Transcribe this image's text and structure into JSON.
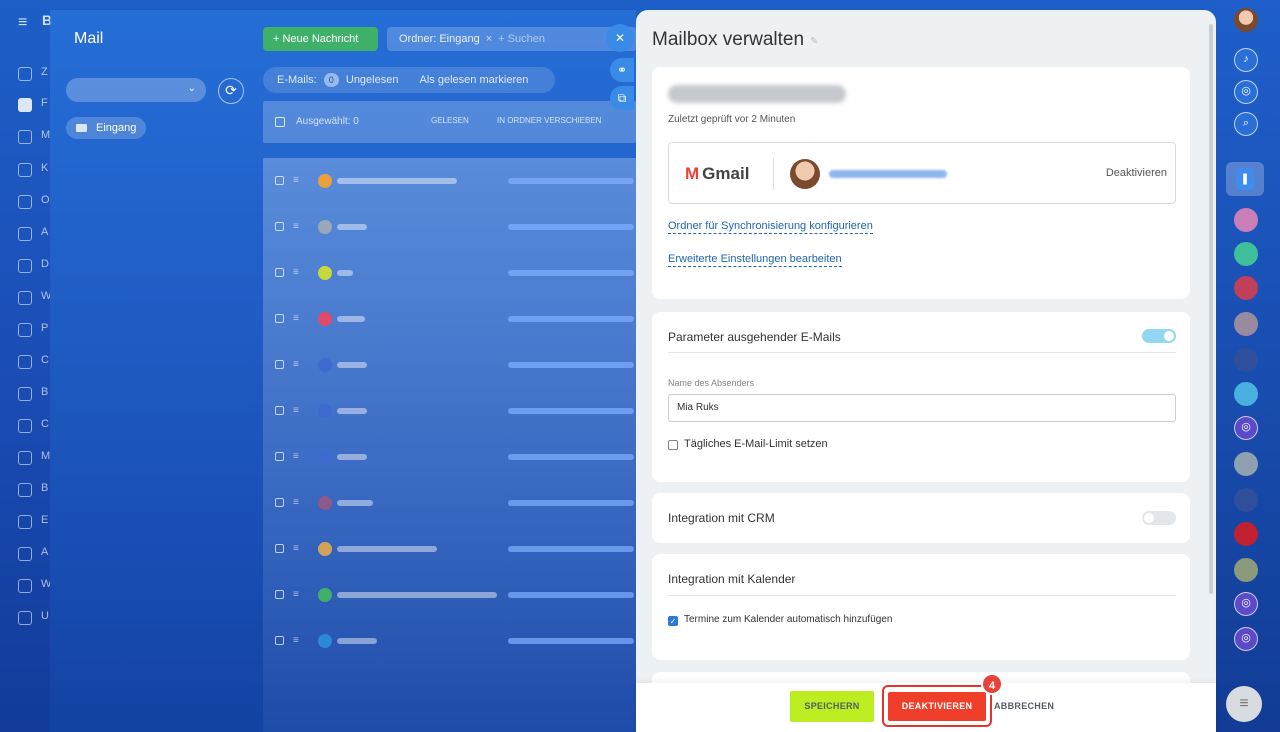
{
  "left_nav": {
    "first_letter": "B",
    "letters": [
      "Z",
      "F",
      "M",
      "K",
      "O",
      "A",
      "D",
      "W",
      "P",
      "C",
      "B",
      "C",
      "M",
      "B",
      "E",
      "A",
      "W",
      "U"
    ]
  },
  "mail": {
    "title": "Mail",
    "folder": "Eingang",
    "new_message": "+ Neue Nachricht",
    "folder_filter": "Ordner: Eingang",
    "filter_close": "×",
    "search_placeholder": "+ Suchen",
    "emails_label": "E-Mails:",
    "unread_count": "0",
    "unread_label": "Ungelesen",
    "mark_read": "Als gelesen markieren",
    "selected": "Ausgewählt: 0",
    "action_read": "GELESEN",
    "action_move": "IN ORDNER VERSCHIEBEN"
  },
  "panel": {
    "title": "Mailbox verwalten",
    "last_checked": "Zuletzt geprüft vor 2 Minuten",
    "provider": "Gmail",
    "deactivate_link": "Deaktivieren",
    "link_sync": "Ordner für Synchronisierung konfigurieren",
    "link_advanced": "Erweiterte Einstellungen bearbeiten",
    "outgoing_title": "Parameter ausgehender E-Mails",
    "sender_label": "Name des Absenders",
    "sender_value": "Mia Ruks",
    "daily_limit": "Tägliches E-Mail-Limit setzen",
    "crm_title": "Integration mit CRM",
    "calendar_title": "Integration mit Kalender",
    "calendar_auto": "Termine zum Kalender automatisch hinzufügen"
  },
  "footer": {
    "save": "SPEICHERN",
    "deactivate": "DEAKTIVIEREN",
    "cancel": "ABBRECHEN",
    "step_badge": "4"
  },
  "colors": {
    "save": "#bbed21",
    "deactivate": "#ef3f2b",
    "link": "#2066b0"
  }
}
